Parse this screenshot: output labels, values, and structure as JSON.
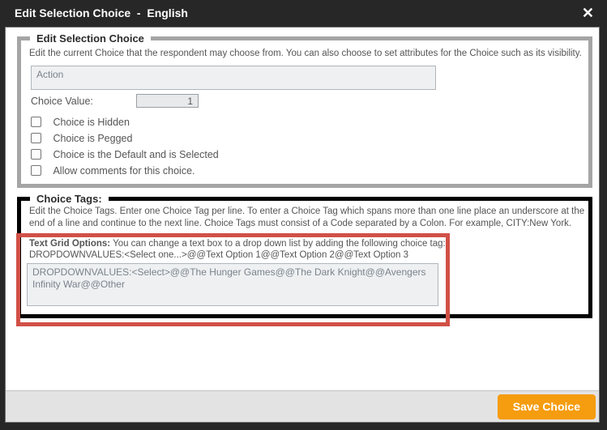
{
  "titlebar": {
    "title": "Edit Selection Choice  -  English",
    "close_icon": "✕"
  },
  "edit_section": {
    "legend": "Edit Selection Choice",
    "description": "Edit the current Choice that the respondent may choose from. You can also choose to set attributes for the Choice such as its visibility.",
    "choice_text_value": "Action",
    "choice_value": {
      "label": "Choice Value:",
      "value": "1"
    },
    "checkboxes": [
      {
        "label": "Choice is Hidden",
        "checked": false
      },
      {
        "label": "Choice is Pegged",
        "checked": false
      },
      {
        "label": "Choice is the Default and is Selected",
        "checked": false
      },
      {
        "label": "Allow comments for this choice.",
        "checked": false
      }
    ]
  },
  "tags_section": {
    "legend": "Choice Tags:",
    "description": "Edit the Choice Tags. Enter one Choice Tag per line. To enter a Choice Tag which spans more than one line place an underscore at the end of a line and continue to the next line. Choice Tags must consist of a Code separated by a Colon. For example, CITY:New York.",
    "text_grid_note": {
      "label": "Text Grid Options:",
      "text": " You can change a text box to a drop down list by adding the following choice tag:",
      "example": "DROPDOWNVALUES:<Select one...>@@Text Option 1@@Text Option 2@@Text Option 3"
    },
    "tags_value": "DROPDOWNVALUES:<Select>@@The Hunger Games@@The Dark Knight@@Avengers Infinity War@@Other"
  },
  "annotation": {
    "highlight_color": "#d15046"
  },
  "footer": {
    "save_label": "Save Choice",
    "accent_color": "#f59c0f"
  }
}
